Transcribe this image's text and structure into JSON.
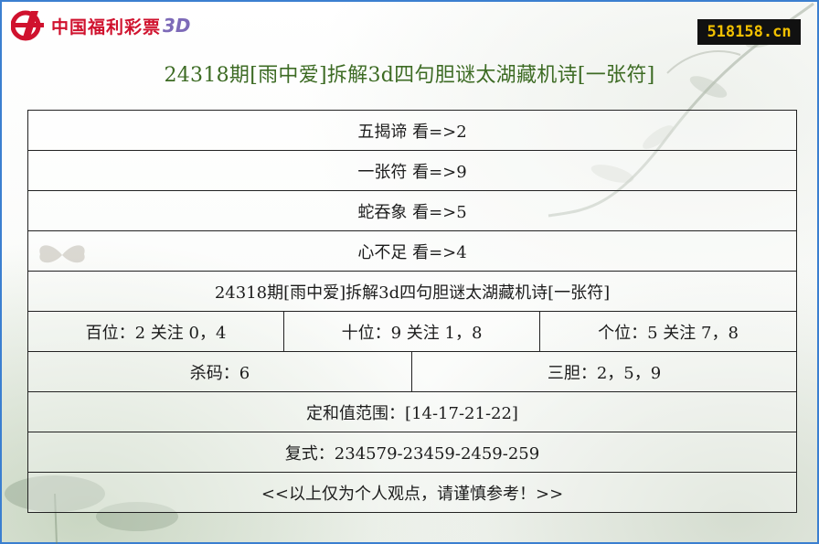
{
  "logo": {
    "text": "中国福利彩票",
    "suffix": "3D"
  },
  "site_badge": "518158.cn",
  "title": "24318期[雨中爱]拆解3d四句胆谜太湖藏机诗[一张符]",
  "riddles": [
    "五揭谛 看=>2",
    "一张符 看=>9",
    "蛇吞象 看=>5",
    "心不足 看=>4"
  ],
  "subtitle": "24318期[雨中爱]拆解3d四句胆谜太湖藏机诗[一张符]",
  "positions": {
    "hundreds": "百位：2 关注 0，4",
    "tens": "十位：9 关注 1，8",
    "units": "个位：5 关注 7，8"
  },
  "kill_code": "杀码：6",
  "three_dan": "三胆：2，5，9",
  "sum_range": "定和值范围：[14-17-21-22]",
  "compound": "复式：234579-23459-2459-259",
  "disclaimer": "<<以上仅为个人观点，请谨慎参考！>>"
}
